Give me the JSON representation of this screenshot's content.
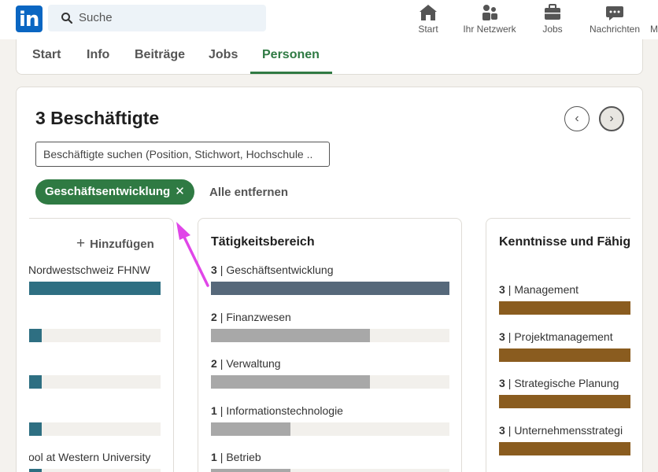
{
  "nav": {
    "logo_text": "in",
    "search_placeholder": "Suche",
    "items": [
      {
        "label": "Start",
        "icon": "home-icon"
      },
      {
        "label": "Ihr Netzwerk",
        "icon": "network-icon"
      },
      {
        "label": "Jobs",
        "icon": "briefcase-icon"
      },
      {
        "label": "Nachrichten",
        "icon": "messaging-icon"
      },
      {
        "label": "M",
        "icon": ""
      }
    ]
  },
  "tabs": [
    {
      "label": "Start"
    },
    {
      "label": "Info"
    },
    {
      "label": "Beiträge"
    },
    {
      "label": "Jobs"
    },
    {
      "label": "Personen",
      "active": true
    }
  ],
  "employees": {
    "title": "3 Beschäftigte",
    "search_placeholder": "Beschäftigte suchen (Position, Stichwort, Hochschule ..",
    "active_filter": "Geschäftsentwicklung",
    "remove_all": "Alle entfernen",
    "prev_symbol": "‹",
    "next_symbol": "›"
  },
  "school_column": {
    "add_label": "Hinzufügen",
    "add_symbol": "+",
    "rows": [
      {
        "label": "Nordwestschweiz FHNW",
        "fraction": 1.0
      },
      {
        "label": "",
        "fraction": 0.1
      },
      {
        "label": "",
        "fraction": 0.1
      },
      {
        "label": "",
        "fraction": 0.1
      },
      {
        "label": "ool at Western University",
        "fraction": 0.1
      }
    ]
  },
  "function_column": {
    "title": "Tätigkeitsbereich",
    "rows": [
      {
        "count": "3",
        "label": "| Geschäftsentwicklung",
        "fraction": 1.0,
        "highlight": true
      },
      {
        "count": "2",
        "label": "| Finanzwesen",
        "fraction": 0.667
      },
      {
        "count": "2",
        "label": "| Verwaltung",
        "fraction": 0.667
      },
      {
        "count": "1",
        "label": "| Informationstechnologie",
        "fraction": 0.333
      },
      {
        "count": "1",
        "label": "| Betrieb",
        "fraction": 0.333
      }
    ]
  },
  "skills_column": {
    "title": "Kenntnisse und Fähigk",
    "rows": [
      {
        "count": "3",
        "label": "| Management",
        "fraction": 1.0
      },
      {
        "count": "3",
        "label": "| Projektmanagement",
        "fraction": 1.0
      },
      {
        "count": "3",
        "label": "| Strategische Planung",
        "fraction": 1.0
      },
      {
        "count": "3",
        "label": "| Unternehmensstrategi",
        "fraction": 1.0
      }
    ]
  },
  "colors": {
    "teal": "#2e6f82",
    "slate": "#56687a",
    "gray": "#a8a8a8",
    "brown": "#8a5c1f",
    "green": "#2f7a43",
    "annotation": "#e046e8"
  }
}
